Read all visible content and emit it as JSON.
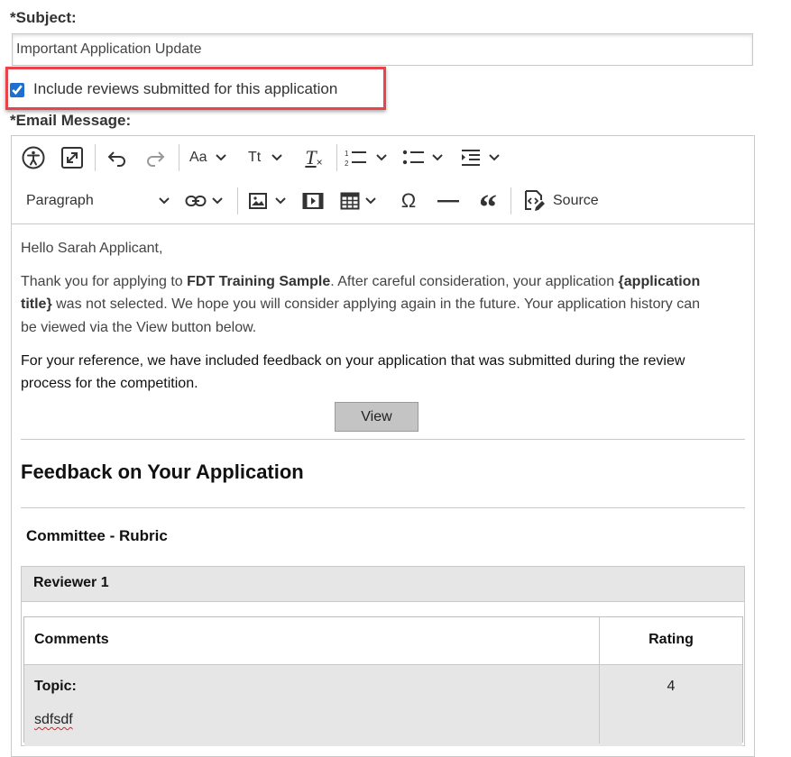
{
  "form": {
    "subject_label": "*Subject:",
    "subject_value": "Important Application Update",
    "include_reviews_label": "Include reviews submitted for this application",
    "include_reviews_checked": true,
    "email_label": "*Email Message:"
  },
  "toolbar": {
    "paragraph_select": "Paragraph",
    "source_label": "Source",
    "font_size_glyph": "Aa",
    "font_family_glyph": "Tt",
    "clear_format_glyph": "T",
    "special_char_glyph": "Ω"
  },
  "message": {
    "greeting": "Hello Sarah Applicant,",
    "p1_a": "Thank you for applying to ",
    "p1_b": "FDT Training Sample",
    "p1_c": ". After careful consideration, your application ",
    "p1_d": "{application",
    "p1_e": "title}",
    "p1_f": " was not selected. We hope you will consider applying again in the future. Your application history can",
    "p1_g": "be viewed via the View button below.",
    "p2_line1": "For your reference, we have included feedback on your application that was submitted during the review",
    "p2_line2": "process for the competition.",
    "view_button": "View",
    "feedback_heading": "Feedback on Your Application",
    "committee_heading": "Committee - Rubric",
    "reviewer": "Reviewer 1",
    "table": {
      "headers": [
        "Comments",
        "Rating"
      ],
      "rows": [
        {
          "topic_label": "Topic:",
          "comment": "sdfsdf",
          "rating": "4"
        }
      ]
    }
  }
}
